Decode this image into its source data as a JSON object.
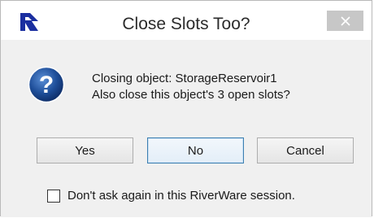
{
  "window": {
    "title": "Close Slots Too?",
    "app_icon": "riverware-logo-icon",
    "close_icon": "close-icon"
  },
  "message": {
    "icon": "question-icon",
    "line1": "Closing object: StorageReservoir1",
    "line2": "Also close this object's 3 open slots?"
  },
  "buttons": {
    "yes": "Yes",
    "no": "No",
    "cancel": "Cancel"
  },
  "checkbox": {
    "label": "Don't ask again in this RiverWare session.",
    "checked": false
  },
  "colors": {
    "question_icon_fill": "#1f4f9a",
    "app_icon_fill": "#1b2fa0",
    "default_button_border": "#3c7fb1"
  }
}
